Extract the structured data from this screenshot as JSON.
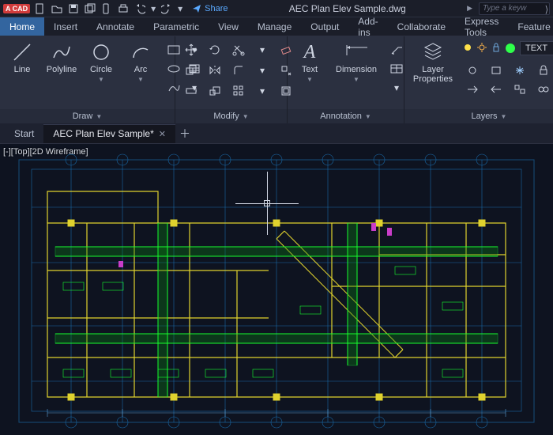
{
  "app_badge": "A CAD",
  "share_label": "Share",
  "doc_title": "AEC Plan Elev Sample.dwg",
  "search_placeholder": "Type a keyw",
  "ribbon_tabs": [
    "Home",
    "Insert",
    "Annotate",
    "Parametric",
    "View",
    "Manage",
    "Output",
    "Add-ins",
    "Collaborate",
    "Express Tools",
    "Feature"
  ],
  "ribbon_active": 0,
  "panels": {
    "draw": {
      "title": "Draw",
      "tools": {
        "line": "Line",
        "polyline": "Polyline",
        "circle": "Circle",
        "arc": "Arc"
      }
    },
    "modify": {
      "title": "Modify"
    },
    "annotation": {
      "title": "Annotation",
      "tools": {
        "text": "Text",
        "dimension": "Dimension"
      }
    },
    "layers": {
      "title": "Layers",
      "properties_label": "Layer\nProperties",
      "current_layer_text": "TEXT"
    }
  },
  "file_tabs": {
    "start": "Start",
    "active": "AEC Plan Elev Sample*"
  },
  "viewport_label": "[-][Top][2D Wireframe]",
  "colors": {
    "accent": "#33659f",
    "duct_green": "#16ff2e",
    "wall_yellow": "#e0d22e",
    "bg": "#0e1320"
  }
}
